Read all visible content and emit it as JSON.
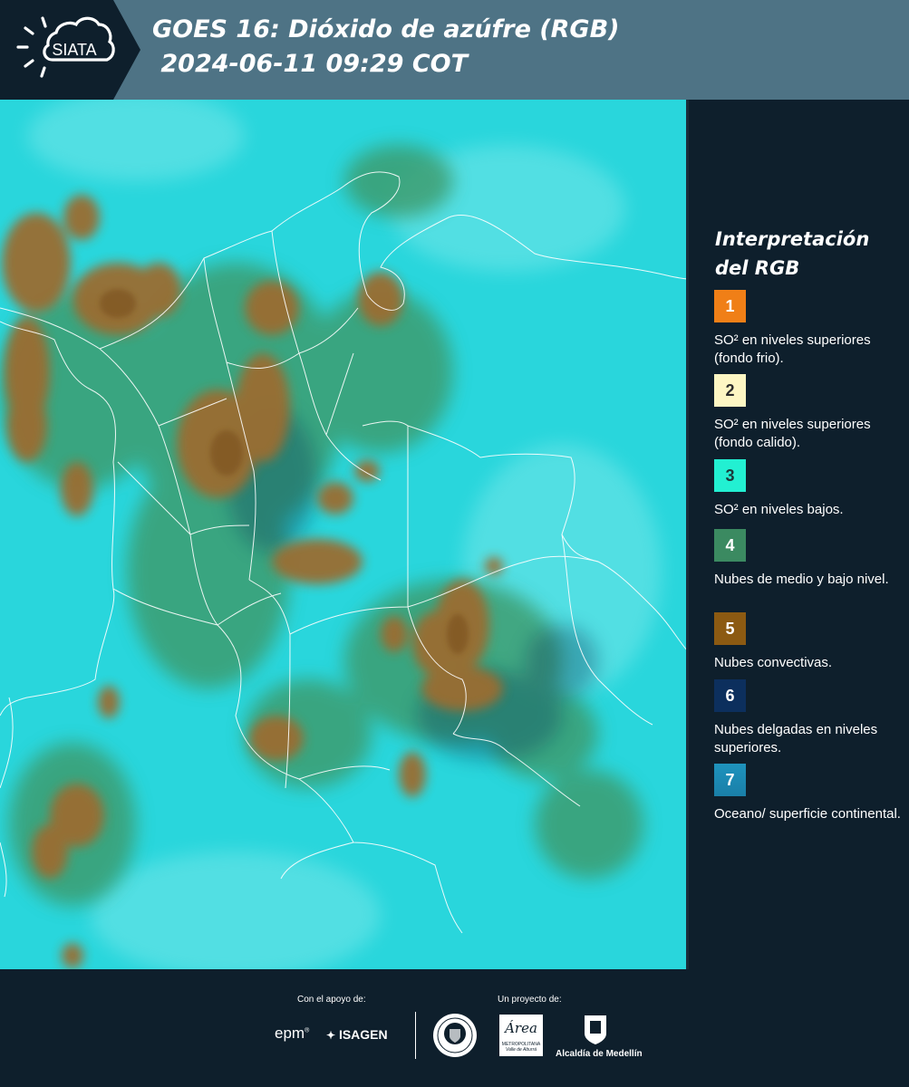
{
  "header": {
    "brand": "SIATA",
    "title_line1": "GOES 16: Dióxido de azúfre (RGB)",
    "title_line2": " 2024-06-11 09:29 COT"
  },
  "legend": {
    "title": "Interpretación del RGB",
    "items": [
      {
        "number": "1",
        "color": "#f07f17",
        "text": "SO² en niveles superiores (fondo frio)."
      },
      {
        "number": "2",
        "color": "#fdf6c3",
        "text": "SO² en niveles superiores (fondo calido)."
      },
      {
        "number": "3",
        "color": "#22f0d2",
        "text": "SO² en niveles bajos."
      },
      {
        "number": "4",
        "color": "#3b8a61",
        "text": "Nubes de medio y bajo nivel."
      },
      {
        "number": "5",
        "color": "#8c5a12",
        "text": "Nubes convectivas."
      },
      {
        "number": "6",
        "color": "#0c2f5d",
        "text": "Nubes delgadas en niveles superiores."
      },
      {
        "number": "7",
        "color": "#1e93bd",
        "text": "Oceano/ superficie continental."
      }
    ]
  },
  "footer": {
    "support_label": "Con el apoyo de:",
    "project_label": "Un proyecto de:",
    "sponsors": [
      "epm",
      "ISAGEN"
    ],
    "area_name": "Área",
    "area_sub": "METROPOLITANA",
    "area_sub2": "Valle de Aburrá",
    "alcaldia": "Alcaldía de Medellín"
  },
  "colors": {
    "header": "#4e7385",
    "background": "#0e1f2c",
    "map_base": "#29d6dc",
    "cloud_brown": "#9a6d30",
    "cloud_green": "#3c9a6a"
  }
}
